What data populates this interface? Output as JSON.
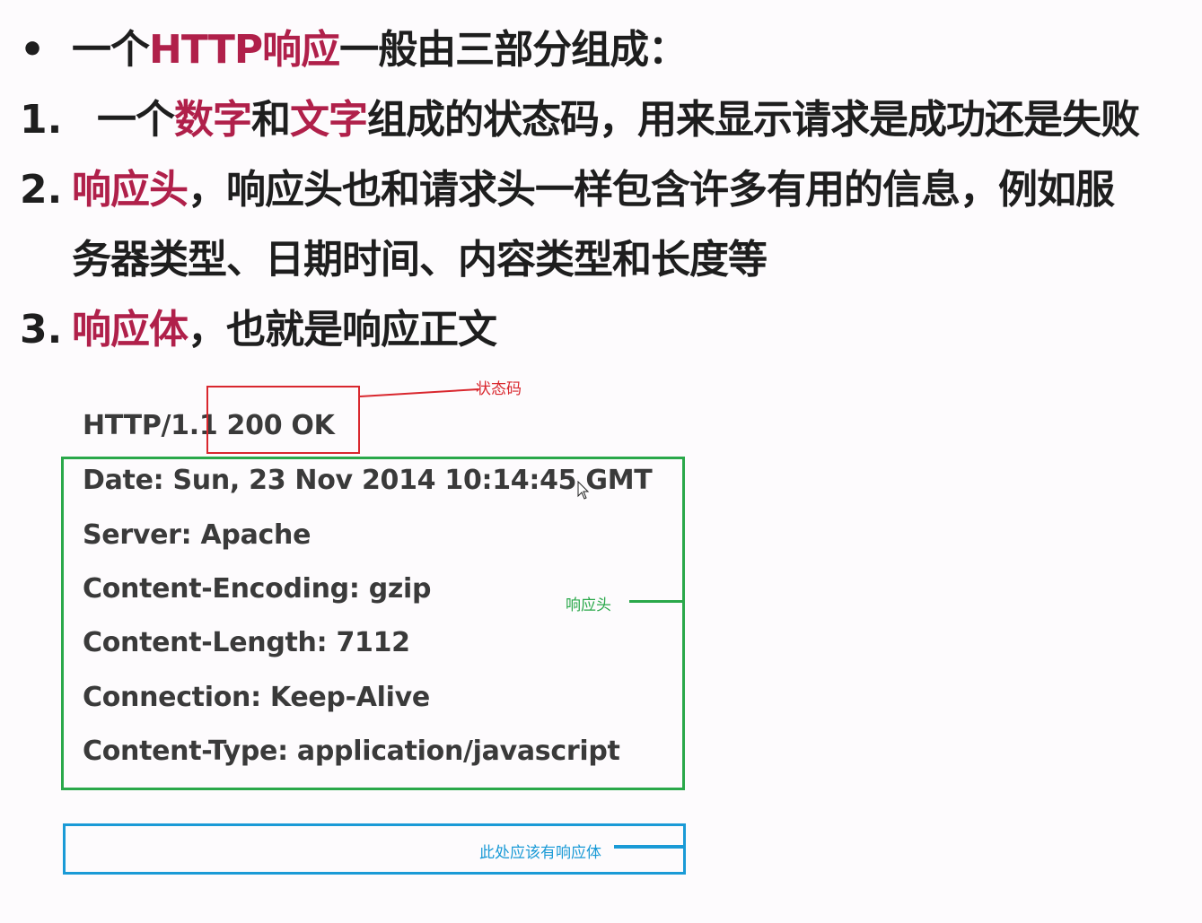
{
  "bullet_intro": {
    "marker": "•",
    "pre": "一个",
    "hl": "HTTP响应",
    "post": "一般由三部分组成："
  },
  "items": [
    {
      "marker": "1.",
      "p1": "一个",
      "hl1": "数字",
      "p2": "和",
      "hl2": "文字",
      "p3": "组成的状态码，用来显示请求是成功还是失败"
    },
    {
      "marker": "2.",
      "hl": "响应头",
      "text": "，响应头也和请求头一样包含许多有用的信息，例如服",
      "continuation": "务器类型、日期时间、内容类型和长度等"
    },
    {
      "marker": "3.",
      "hl": "响应体",
      "text": "，也就是响应正文"
    }
  ],
  "http_response": {
    "status_line": "HTTP/1.1 200 OK",
    "headers": [
      "Date: Sun, 23 Nov 2014 10:14:45 GMT",
      "Server: Apache",
      "Content-Encoding: gzip",
      "Content-Length: 7112",
      "Connection: Keep-Alive",
      "Content-Type: application/javascript"
    ]
  },
  "annotations": {
    "status_code": "状态码",
    "response_headers": "响应头",
    "response_body": "此处应该有响应体"
  },
  "colors": {
    "highlight": "#b0204a",
    "status_box": "#d9272e",
    "header_box": "#2aa84a",
    "body_box": "#1a9ad6"
  }
}
